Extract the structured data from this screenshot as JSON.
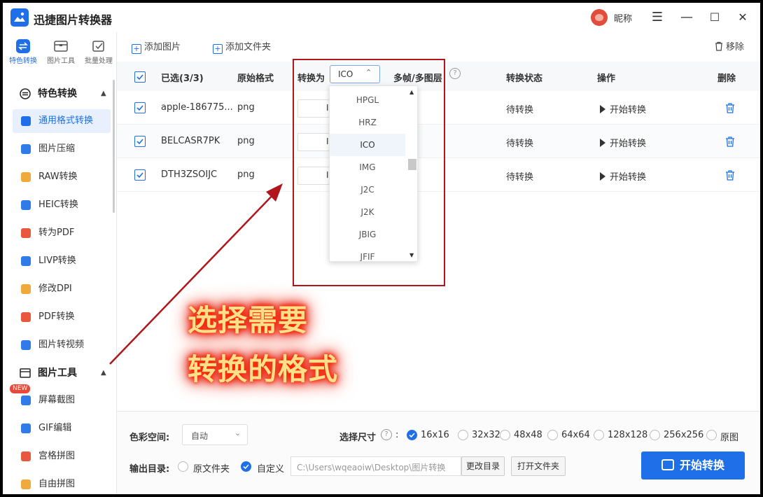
{
  "app": {
    "title": "迅捷图片转换器",
    "nickname": "昵称"
  },
  "window": {
    "menu": "☰",
    "minimize": "—",
    "maximize": "☐",
    "close": "✕"
  },
  "top_tabs": [
    {
      "label": "特色转换",
      "active": true
    },
    {
      "label": "图片工具",
      "active": false
    },
    {
      "label": "批量处理",
      "active": false
    }
  ],
  "sidebar": {
    "section1": {
      "label": "特色转换"
    },
    "section1_items": [
      {
        "label": "通用格式转换",
        "active": true,
        "color": "#1f6fe8"
      },
      {
        "label": "图片压缩",
        "color": "#2f7be9"
      },
      {
        "label": "RAW转换",
        "color": "#f0a93b"
      },
      {
        "label": "HEIC转换",
        "color": "#2f7be9"
      },
      {
        "label": "转为PDF",
        "color": "#e9573f"
      },
      {
        "label": "LIVP转换",
        "color": "#2f7be9"
      },
      {
        "label": "修改DPI",
        "color": "#f0a93b"
      },
      {
        "label": "PDF转换",
        "color": "#e9573f"
      },
      {
        "label": "图片转视频",
        "color": "#2f7be9"
      }
    ],
    "section2": {
      "label": "图片工具"
    },
    "new_badge": "NEW",
    "section2_items": [
      {
        "label": "屏幕截图",
        "color": "#2f7be9"
      },
      {
        "label": "GIF编辑",
        "color": "#2f7be9"
      },
      {
        "label": "宫格拼图",
        "color": "#e9573f"
      },
      {
        "label": "自由拼图",
        "color": "#f0a93b"
      }
    ]
  },
  "toolbar": {
    "add_image": "添加图片",
    "add_folder": "添加文件夹",
    "remove": "移除"
  },
  "table": {
    "headers": {
      "selected": "已选(3/3)",
      "orig_format": "原始格式",
      "convert_to": "转换为",
      "multi_frame": "多帧/多图层",
      "status": "转换状态",
      "action": "操作",
      "delete": "删除"
    },
    "convert_to_value": "ICO",
    "rows": [
      {
        "name": "apple-186775...",
        "format": "png",
        "status": "待转换",
        "action": "开始转换"
      },
      {
        "name": "BELCASR7PK",
        "format": "png",
        "status": "待转换",
        "action": "开始转换"
      },
      {
        "name": "DTH3ZSOIJC",
        "format": "png",
        "status": "待转换",
        "action": "开始转换"
      }
    ]
  },
  "dropdown": {
    "options": [
      "HPGL",
      "HRZ",
      "ICO",
      "IMG",
      "J2C",
      "J2K",
      "JBIG",
      "JFIF"
    ],
    "selected": "ICO"
  },
  "annotation": {
    "line1": "选择需要",
    "line2": "转换的格式"
  },
  "bottom": {
    "color_space_label": "色彩空间:",
    "color_space_value": "自动",
    "size_label": "选择尺寸",
    "sizes": [
      {
        "label": "16x16",
        "checked": true
      },
      {
        "label": "32x32",
        "checked": false
      },
      {
        "label": "48x48",
        "checked": false
      },
      {
        "label": "64x64",
        "checked": false
      },
      {
        "label": "128x128",
        "checked": false
      },
      {
        "label": "256x256",
        "checked": false
      },
      {
        "label": "原图",
        "checked": false
      }
    ],
    "output_label": "输出目录:",
    "output_original": "原文件夹",
    "output_custom": "自定义",
    "output_path": "C:\\Users\\wqeaoiw\\Desktop\\图片转换",
    "change_dir": "更改目录",
    "open_folder": "打开文件夹",
    "start": "开始转换"
  },
  "colors": {
    "accent": "#1f6fe8",
    "annotation_red": "#b0161b"
  }
}
